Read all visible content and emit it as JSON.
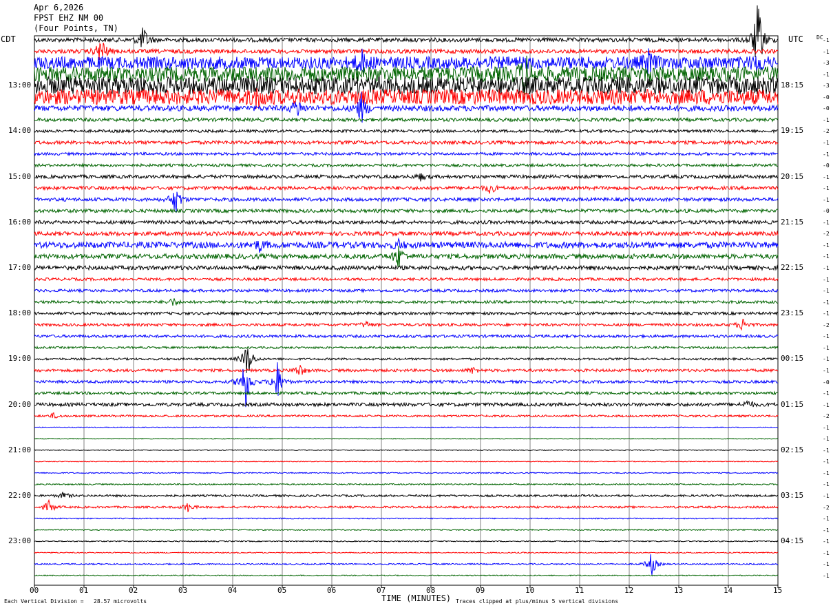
{
  "header": {
    "date": "Apr 6,2026",
    "station": "FPST EHZ NM 00",
    "location": "(Four Points, TN)"
  },
  "left_axis_label": "CDT",
  "right_axis_label": "UTC",
  "dc_label": "DC",
  "footer": {
    "scale_note": "Each Vertical Division =   28.57 microvolts",
    "xlabel": "TIME (MINUTES)",
    "clip_note": "Traces clipped at plus/minus 5 vertical divisions"
  },
  "chart_data": {
    "type": "line",
    "title": "FPST EHZ NM 00 (Four Points, TN) Apr 6,2026",
    "xlabel": "TIME (MINUTES)",
    "xlim": [
      0,
      15
    ],
    "x_ticks": [
      "00",
      "01",
      "02",
      "03",
      "04",
      "05",
      "06",
      "07",
      "08",
      "09",
      "10",
      "11",
      "12",
      "13",
      "14",
      "15"
    ],
    "trace_minutes": 15,
    "trace_count": 48,
    "trace_colors": [
      "#000000",
      "#ff0000",
      "#0000ff",
      "#006400"
    ],
    "cdt_labels": [
      "13:00",
      "14:00",
      "15:00",
      "16:00",
      "17:00",
      "18:00",
      "19:00",
      "20:00",
      "21:00",
      "22:00",
      "23:00"
    ],
    "utc_labels": [
      "18:15",
      "19:15",
      "20:15",
      "21:15",
      "22:15",
      "23:15",
      "00:15",
      "01:15",
      "02:15",
      "03:15",
      "04:15"
    ],
    "dc_offsets": [
      "-1",
      "-1",
      "-3",
      "-1",
      "-3",
      "-0",
      "-0",
      "-1",
      "-2",
      "-1",
      "-1",
      "-0",
      "-1",
      "-1",
      "-1",
      "-0",
      "-1",
      "-2",
      "-1",
      "-1",
      "-1",
      "-1",
      "-1",
      "-1",
      "-1",
      "-2",
      "-1",
      "-1",
      "-1",
      "-1",
      "-0",
      "-1",
      "-1",
      "-2",
      "-1",
      "-1",
      "-1",
      "-1",
      "-1",
      "-1",
      "-1",
      "-2",
      "-1",
      "-1",
      "-1",
      "-1",
      "-1",
      "-1"
    ],
    "trace_activity": [
      {
        "row": 0,
        "base": 3,
        "events": [
          {
            "minute": 2.2,
            "amp": 20
          },
          {
            "minute": 14.6,
            "amp": 60
          }
        ]
      },
      {
        "row": 1,
        "base": 3,
        "events": [
          {
            "minute": 1.35,
            "amp": 22
          }
        ]
      },
      {
        "row": 2,
        "base": 9,
        "events": [
          {
            "minute": 6.6,
            "amp": 14
          },
          {
            "minute": 12.4,
            "amp": 16
          },
          {
            "minute": 14.6,
            "amp": 12
          }
        ]
      },
      {
        "row": 3,
        "base": 11,
        "events": [
          {
            "minute": 9.9,
            "amp": 26
          }
        ]
      },
      {
        "row": 4,
        "base": 13,
        "events": []
      },
      {
        "row": 5,
        "base": 11,
        "events": [
          {
            "minute": 4.5,
            "amp": 12
          }
        ]
      },
      {
        "row": 6,
        "base": 4,
        "events": [
          {
            "minute": 5.3,
            "amp": 14
          },
          {
            "minute": 6.6,
            "amp": 22
          }
        ]
      },
      {
        "row": 7,
        "base": 2.5,
        "events": []
      },
      {
        "row": 8,
        "base": 2,
        "events": []
      },
      {
        "row": 9,
        "base": 2.5,
        "events": []
      },
      {
        "row": 10,
        "base": 2,
        "events": []
      },
      {
        "row": 11,
        "base": 2,
        "events": []
      },
      {
        "row": 12,
        "base": 2.5,
        "events": [
          {
            "minute": 7.8,
            "amp": 5
          }
        ]
      },
      {
        "row": 13,
        "base": 2.5,
        "events": [
          {
            "minute": 9.2,
            "amp": 8
          }
        ]
      },
      {
        "row": 14,
        "base": 2.5,
        "events": [
          {
            "minute": 2.85,
            "amp": 22
          }
        ]
      },
      {
        "row": 15,
        "base": 2.5,
        "events": []
      },
      {
        "row": 16,
        "base": 2.5,
        "events": []
      },
      {
        "row": 17,
        "base": 3,
        "events": []
      },
      {
        "row": 18,
        "base": 4.5,
        "events": [
          {
            "minute": 4.55,
            "amp": 8
          },
          {
            "minute": 7.35,
            "amp": 6
          }
        ]
      },
      {
        "row": 19,
        "base": 3.5,
        "events": [
          {
            "minute": 7.35,
            "amp": 18
          }
        ]
      },
      {
        "row": 20,
        "base": 3,
        "events": []
      },
      {
        "row": 21,
        "base": 2,
        "events": []
      },
      {
        "row": 22,
        "base": 2,
        "events": []
      },
      {
        "row": 23,
        "base": 2,
        "events": [
          {
            "minute": 2.8,
            "amp": 6
          }
        ]
      },
      {
        "row": 24,
        "base": 2,
        "events": []
      },
      {
        "row": 25,
        "base": 2,
        "events": [
          {
            "minute": 6.7,
            "amp": 5
          },
          {
            "minute": 14.3,
            "amp": 10
          }
        ]
      },
      {
        "row": 26,
        "base": 2,
        "events": []
      },
      {
        "row": 27,
        "base": 1.5,
        "events": []
      },
      {
        "row": 28,
        "base": 1.5,
        "events": [
          {
            "minute": 4.3,
            "amp": 30
          }
        ]
      },
      {
        "row": 29,
        "base": 2,
        "events": [
          {
            "minute": 5.35,
            "amp": 10
          },
          {
            "minute": 8.85,
            "amp": 5
          }
        ]
      },
      {
        "row": 30,
        "base": 2,
        "events": [
          {
            "minute": 4.25,
            "amp": 45
          },
          {
            "minute": 4.9,
            "amp": 30
          }
        ]
      },
      {
        "row": 31,
        "base": 2,
        "events": []
      },
      {
        "row": 32,
        "base": 2.5,
        "events": [
          {
            "minute": 14.4,
            "amp": 6
          }
        ]
      },
      {
        "row": 33,
        "base": 1.5,
        "events": [
          {
            "minute": 0.4,
            "amp": 4
          }
        ]
      },
      {
        "row": 34,
        "base": 0.6,
        "events": []
      },
      {
        "row": 35,
        "base": 0.6,
        "events": []
      },
      {
        "row": 36,
        "base": 0.6,
        "events": []
      },
      {
        "row": 37,
        "base": 0.6,
        "events": []
      },
      {
        "row": 38,
        "base": 0.8,
        "events": []
      },
      {
        "row": 39,
        "base": 1,
        "events": []
      },
      {
        "row": 40,
        "base": 1.5,
        "events": [
          {
            "minute": 0.6,
            "amp": 6
          }
        ]
      },
      {
        "row": 41,
        "base": 1.5,
        "events": [
          {
            "minute": 3.1,
            "amp": 7
          },
          {
            "minute": 0.3,
            "amp": 10
          }
        ]
      },
      {
        "row": 42,
        "base": 0.8,
        "events": []
      },
      {
        "row": 43,
        "base": 0.8,
        "events": []
      },
      {
        "row": 44,
        "base": 0.8,
        "events": []
      },
      {
        "row": 45,
        "base": 0.8,
        "events": []
      },
      {
        "row": 46,
        "base": 1,
        "events": [
          {
            "minute": 12.45,
            "amp": 18
          }
        ]
      },
      {
        "row": 47,
        "base": 0.8,
        "events": []
      }
    ]
  }
}
